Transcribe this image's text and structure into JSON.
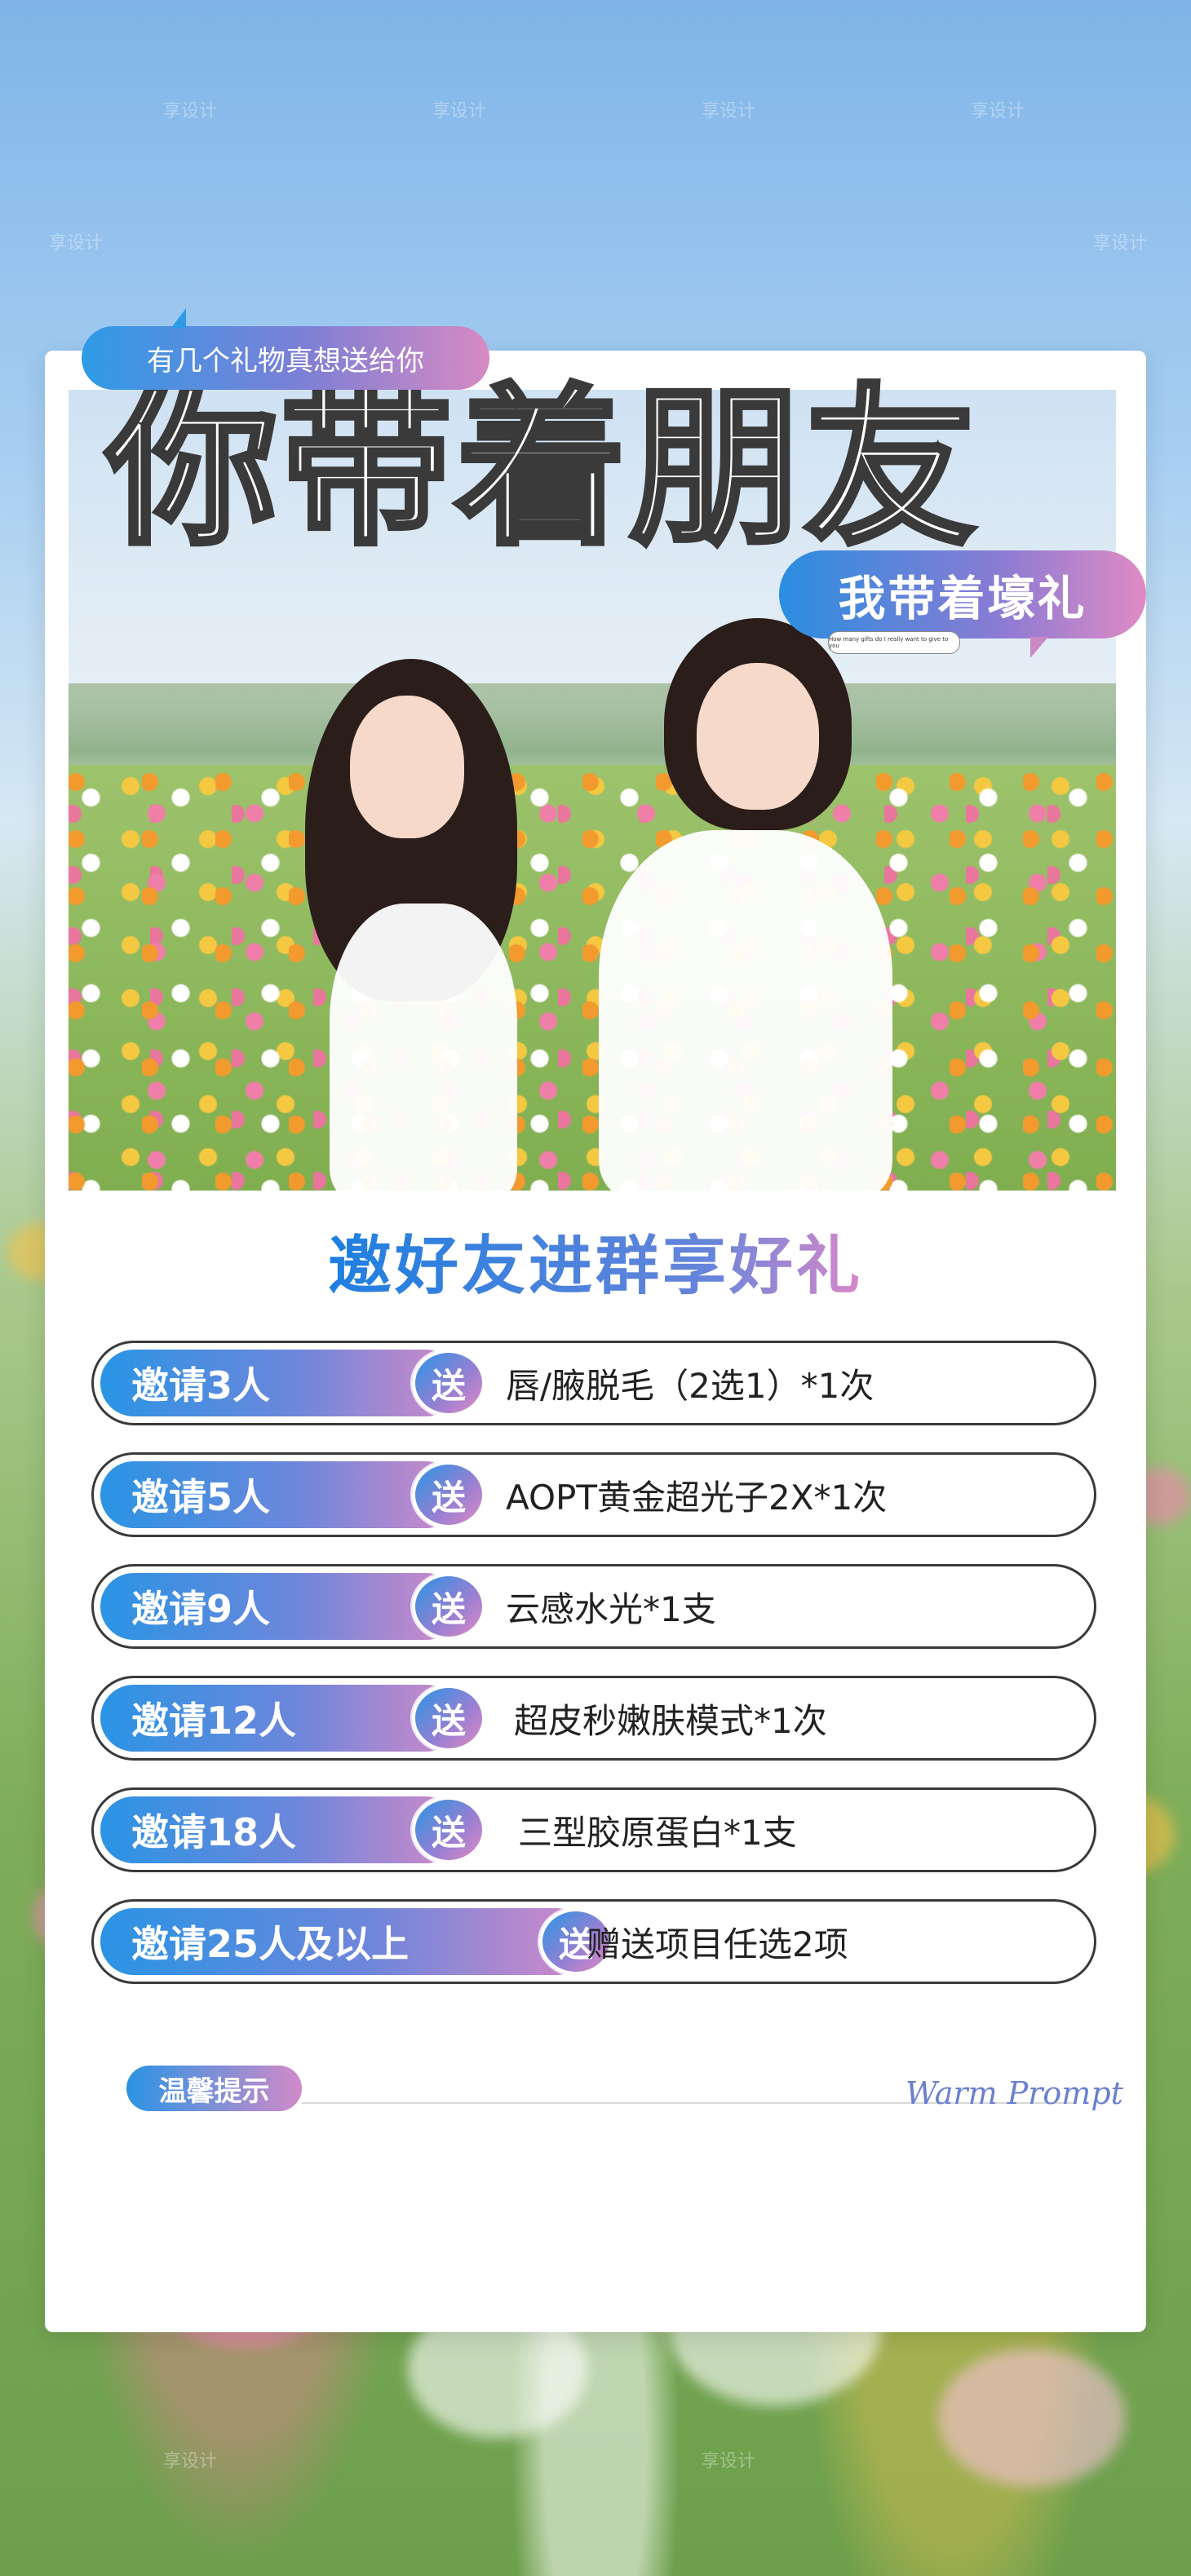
{
  "header": {
    "speech_bubble": "有几个礼物真想送给你",
    "headline": "你带着朋友",
    "gift_bubble": "我带着壕礼",
    "tiny_caption": "How many gifts do I really want to give to you"
  },
  "section_title": {
    "part1": "邀好友进群享",
    "part2": "好礼"
  },
  "rewards": [
    {
      "invite": "邀请3人",
      "send": "送",
      "gift": "唇/腋脱毛（2选1）*1次"
    },
    {
      "invite": "邀请5人",
      "send": "送",
      "gift": "AOPT黄金超光子2X*1次"
    },
    {
      "invite": "邀请9人",
      "send": "送",
      "gift": "云感水光*1支"
    },
    {
      "invite": "邀请12人",
      "send": "送",
      "gift": "超皮秒嫩肤模式*1次"
    },
    {
      "invite": "邀请18人",
      "send": "送",
      "gift": "三型胶原蛋白*1支"
    },
    {
      "invite": "邀请25人及以上",
      "send": "送",
      "gift": "赠送项目任选2项"
    }
  ],
  "tip": {
    "label": "温馨提示",
    "script": "Warm Prompt"
  },
  "colors": {
    "accent_blue": "#2a94e4",
    "accent_purple": "#6e86db",
    "accent_pink": "#d28ac8"
  },
  "watermark": "享设计"
}
